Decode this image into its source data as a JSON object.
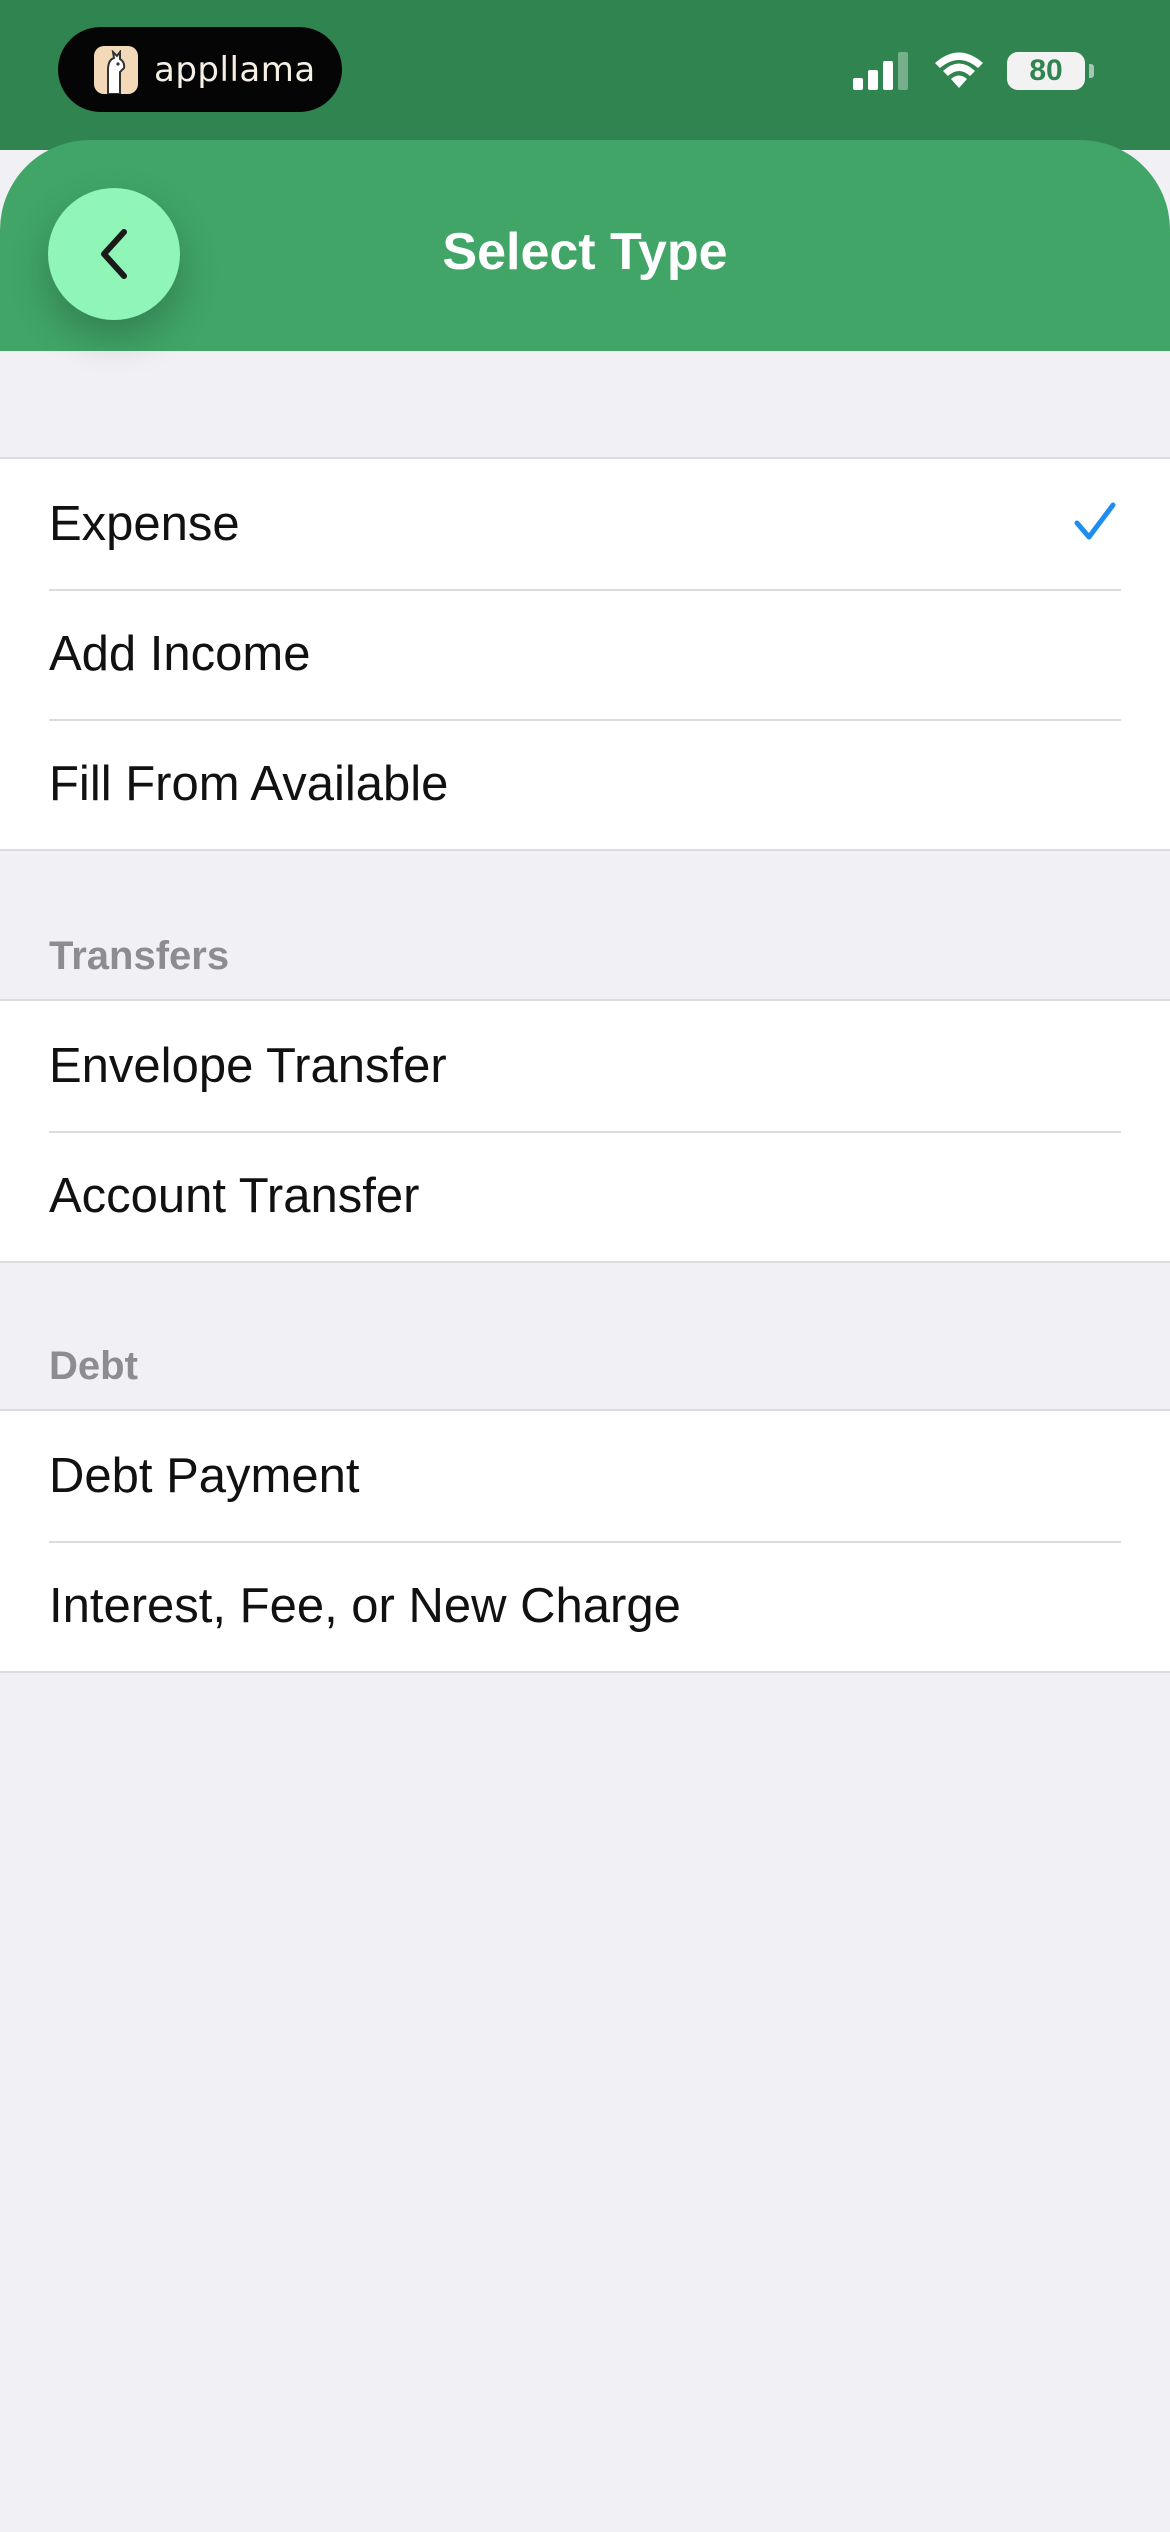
{
  "status_bar": {
    "app_badge": "appllama",
    "battery": "80"
  },
  "header": {
    "title": "Select Type"
  },
  "sections": [
    {
      "header": "",
      "items": [
        {
          "label": "Expense",
          "selected": true
        },
        {
          "label": "Add Income",
          "selected": false
        },
        {
          "label": "Fill From Available",
          "selected": false
        }
      ]
    },
    {
      "header": "Transfers",
      "items": [
        {
          "label": "Envelope Transfer",
          "selected": false
        },
        {
          "label": "Account Transfer",
          "selected": false
        }
      ]
    },
    {
      "header": "Debt",
      "items": [
        {
          "label": "Debt Payment",
          "selected": false
        },
        {
          "label": "Interest, Fee, or New Charge",
          "selected": false
        }
      ]
    }
  ],
  "colors": {
    "status_bar": "#2f8450",
    "header": "#41a567",
    "back_button": "#8ff6b7",
    "checkmark": "#1e8cf0",
    "background": "#f0f0f5"
  },
  "icons": {
    "back": "chevron-left-icon",
    "selected": "checkmark-icon",
    "signal": "cellular-signal-icon",
    "wifi": "wifi-icon",
    "battery": "battery-icon"
  }
}
